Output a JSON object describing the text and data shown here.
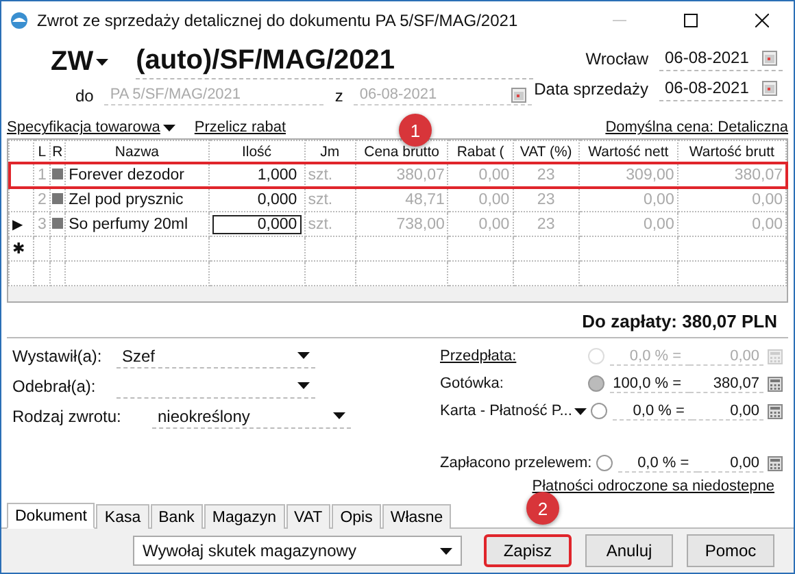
{
  "window": {
    "title": "Zwrot ze sprzedaży detalicznej do dokumentu PA 5/SF/MAG/2021"
  },
  "header": {
    "doc_type": "ZW",
    "number": "(auto)/SF/MAG/2021",
    "do_label": "do",
    "do_value": "PA 5/SF/MAG/2021",
    "z_label": "z",
    "z_value": "06-08-2021",
    "dates": [
      {
        "label": "Wrocław",
        "value": "06-08-2021"
      },
      {
        "label": "Data sprzedaży",
        "value": "06-08-2021"
      }
    ]
  },
  "toolbar": {
    "spec": "Specyfikacja towarowa",
    "recalc": "Przelicz rabat",
    "default_price": "Domyślna cena: Detaliczna"
  },
  "table": {
    "columns": [
      "L",
      "R",
      "Nazwa",
      "Ilość",
      "Jm",
      "Cena brutto",
      "Rabat (",
      "VAT (%)",
      "Wartość nett",
      "Wartość brutt"
    ],
    "rows": [
      {
        "indicator": "",
        "lp": "1",
        "name": "Forever dezodor",
        "qty": "1,000",
        "unit": "szt.",
        "price": "380,07",
        "discount": "0,00",
        "vat": "23",
        "net": "309,00",
        "gross": "380,07",
        "highlighted": true,
        "editing": false
      },
      {
        "indicator": "",
        "lp": "2",
        "name": "Zel pod prysznic",
        "qty": "0,000",
        "unit": "szt.",
        "price": "48,71",
        "discount": "0,00",
        "vat": "23",
        "net": "0,00",
        "gross": "0,00",
        "highlighted": false,
        "editing": false
      },
      {
        "indicator": "▶",
        "lp": "3",
        "name": "So perfumy 20ml",
        "qty": "0,000",
        "unit": "szt.",
        "price": "738,00",
        "discount": "0,00",
        "vat": "23",
        "net": "0,00",
        "gross": "0,00",
        "highlighted": false,
        "editing": true
      }
    ],
    "new_row_indicator": "✱"
  },
  "total": "Do zapłaty: 380,07 PLN",
  "left_fields": [
    {
      "label": "Wystawił(a):",
      "value": "Szef"
    },
    {
      "label": "Odebrał(a):"
    },
    {
      "label": "Rodzaj zwrotu:",
      "value": "nieokreślony"
    }
  ],
  "payments": [
    {
      "label": "Przedpłata:",
      "kind": "link",
      "percent": "0,0 % =",
      "amount": "0,00",
      "selected": false,
      "disabled": true
    },
    {
      "label": "Gotówka:",
      "kind": "plain",
      "percent": "100,0 % =",
      "amount": "380,07",
      "selected": true,
      "disabled": false
    },
    {
      "label": "Karta - Płatność P...",
      "kind": "dropdown",
      "percent": "0,0 % =",
      "amount": "0,00",
      "selected": false,
      "disabled": false
    },
    {
      "label": "Zapłacono przelewem:",
      "kind": "spaced",
      "percent": "0,0 % =",
      "amount": "0,00",
      "selected": false,
      "disabled": false
    }
  ],
  "deferred_link": "Płatności odroczone sa niedostepne",
  "tabs": [
    {
      "label": "Dokument",
      "selected": true
    },
    {
      "label": "Kasa",
      "selected": false
    },
    {
      "label": "Bank",
      "selected": false
    },
    {
      "label": "Magazyn",
      "selected": false
    },
    {
      "label": "VAT",
      "selected": false
    },
    {
      "label": "Opis",
      "selected": false
    },
    {
      "label": "Własne",
      "selected": false
    }
  ],
  "action_select": "Wywołaj skutek magazynowy",
  "buttons": [
    {
      "label": "Zapisz",
      "highlighted": true
    },
    {
      "label": "Anuluj",
      "highlighted": false
    },
    {
      "label": "Pomoc",
      "highlighted": false
    }
  ],
  "annotations": [
    {
      "label": "1"
    },
    {
      "label": "2"
    }
  ]
}
